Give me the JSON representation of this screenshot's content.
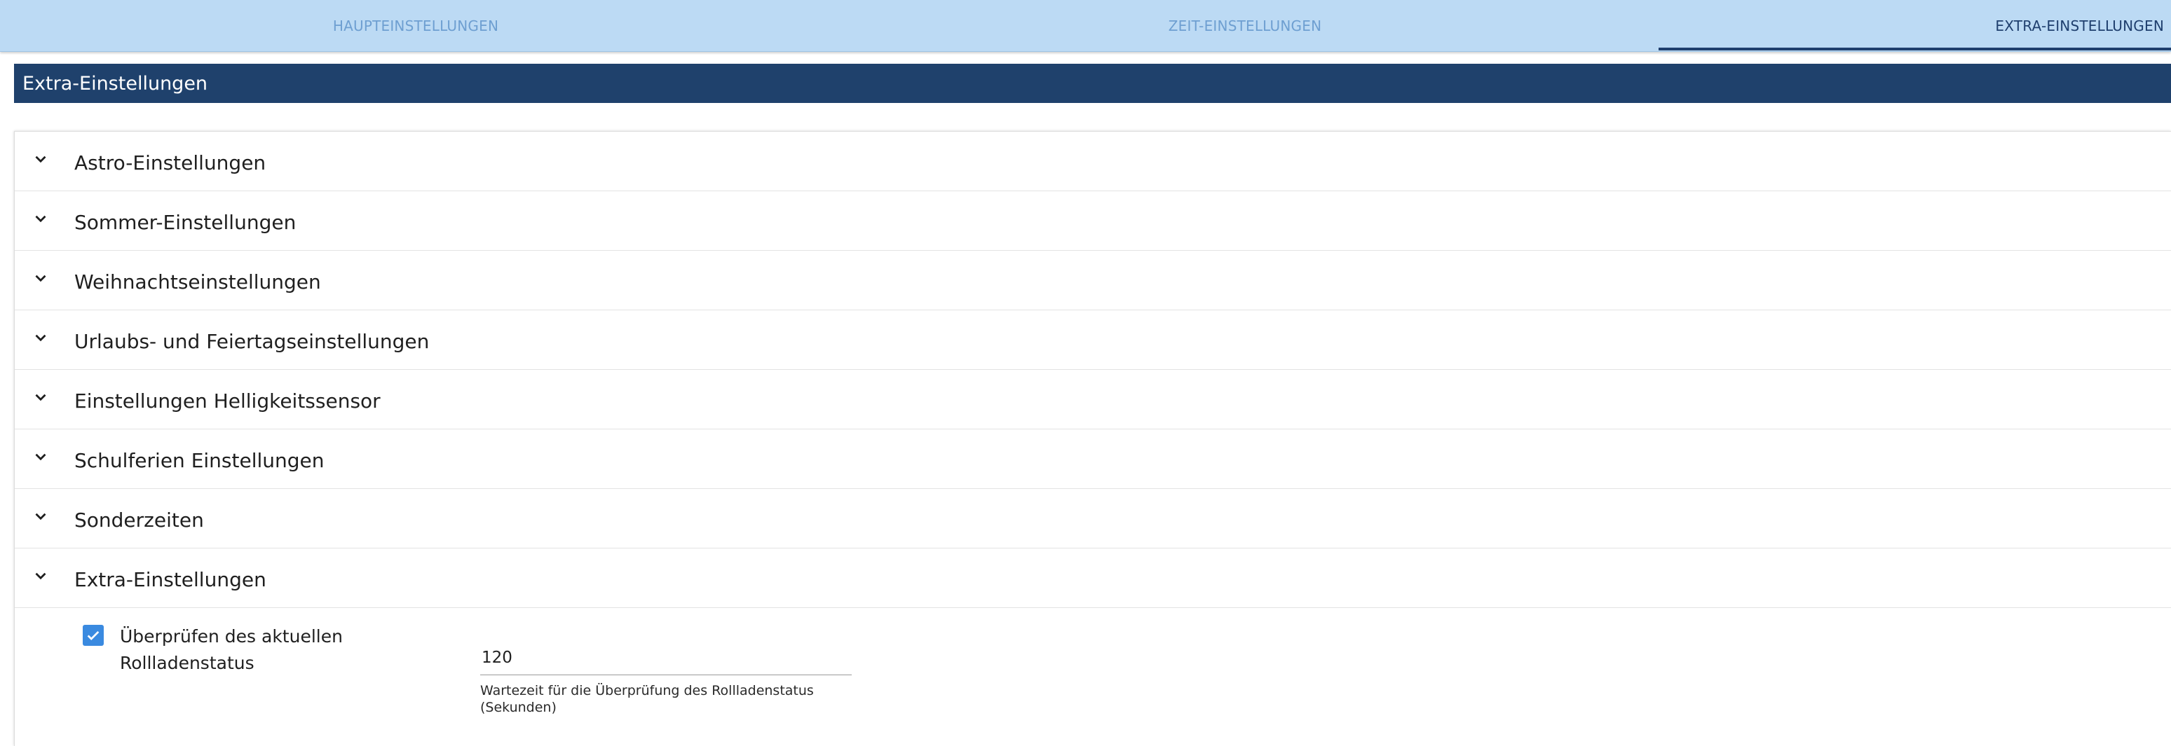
{
  "tabs": [
    {
      "label": "HAUPTEINSTELLUNGEN",
      "active": false
    },
    {
      "label": "ZEIT-EINSTELLUNGEN",
      "active": false
    },
    {
      "label": "EXTRA-EINSTELLUNGEN",
      "active": true
    }
  ],
  "section": {
    "title": "Extra-Einstellungen"
  },
  "accordion": {
    "items": [
      {
        "label": "Astro-Einstellungen",
        "icon": "chevron-down-icon"
      },
      {
        "label": "Sommer-Einstellungen",
        "icon": "chevron-down-icon"
      },
      {
        "label": "Weihnachtseinstellungen",
        "icon": "chevron-down-icon"
      },
      {
        "label": "Urlaubs- und Feiertagseinstellungen",
        "icon": "chevron-down-icon"
      },
      {
        "label": "Einstellungen Helligkeitssensor",
        "icon": "chevron-down-icon"
      },
      {
        "label": "Schulferien Einstellungen",
        "icon": "chevron-down-icon"
      },
      {
        "label": "Sonderzeiten",
        "icon": "chevron-down-icon"
      },
      {
        "label": "Extra-Einstellungen",
        "icon": "chevron-down-icon",
        "expanded": true
      }
    ]
  },
  "extra_panel": {
    "checkbox": {
      "checked": true,
      "label_line1": "Überprüfen des aktuellen",
      "label_line2": "Rollladenstatus"
    },
    "wait_field": {
      "value": "120",
      "helper": "Wartezeit für die Überprüfung des Rollladenstatus (Sekunden)"
    }
  },
  "colors": {
    "tabbar_bg": "#bcdaf4",
    "tab_inactive": "#6e9fd1",
    "tab_active": "#1f3f6e",
    "header_bg": "#1f416c",
    "checkbox": "#3a8ae0"
  }
}
